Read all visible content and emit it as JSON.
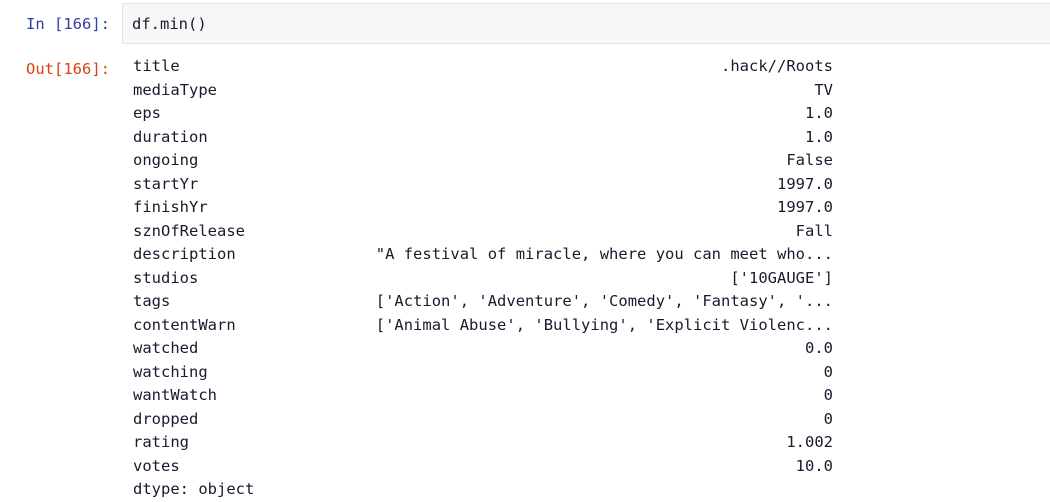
{
  "cell": {
    "input_prompt": "In [166]:",
    "output_prompt": "Out[166]:",
    "input_code": "df.min()",
    "prompt_in_color": "#303F9F",
    "prompt_out_color": "#D84315",
    "input_bg_color": "#f7f7f7",
    "output_text_color": "#1a1a2e"
  },
  "output": {
    "rows": [
      {
        "label": "title",
        "value": ".hack//Roots"
      },
      {
        "label": "mediaType",
        "value": "TV"
      },
      {
        "label": "eps",
        "value": "1.0"
      },
      {
        "label": "duration",
        "value": "1.0"
      },
      {
        "label": "ongoing",
        "value": "False"
      },
      {
        "label": "startYr",
        "value": "1997.0"
      },
      {
        "label": "finishYr",
        "value": "1997.0"
      },
      {
        "label": "sznOfRelease",
        "value": "Fall"
      },
      {
        "label": "description",
        "value": "\"A festival of miracle, where you can meet who..."
      },
      {
        "label": "studios",
        "value": "['10GAUGE']"
      },
      {
        "label": "tags",
        "value": "['Action', 'Adventure', 'Comedy', 'Fantasy', '..."
      },
      {
        "label": "contentWarn",
        "value": "['Animal Abuse', 'Bullying', 'Explicit Violenc..."
      },
      {
        "label": "watched",
        "value": "0.0"
      },
      {
        "label": "watching",
        "value": "0"
      },
      {
        "label": "wantWatch",
        "value": "0"
      },
      {
        "label": "dropped",
        "value": "0"
      },
      {
        "label": "rating",
        "value": "1.002"
      },
      {
        "label": "votes",
        "value": "10.0"
      }
    ],
    "dtype": "dtype: object"
  }
}
